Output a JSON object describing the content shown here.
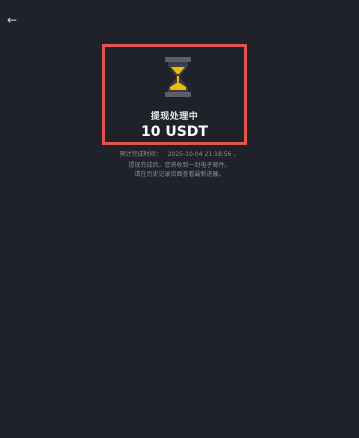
{
  "header": {
    "back_icon": "←"
  },
  "status": {
    "icon": "hourglass-icon",
    "title": "提现处理中",
    "amount": "10 USDT"
  },
  "eta": {
    "label": "预计完成时间：",
    "value": "2025-10-04 21:18:56 。"
  },
  "notice": {
    "line1": "提现完成后，您将收到一封电子邮件。",
    "line2": "请在历史记录页面查看最新进展。"
  },
  "colors": {
    "background": "#1f2228",
    "highlight_border": "#e2524f",
    "hourglass_sand": "#f0b90b",
    "hourglass_frame": "#5a5f69",
    "muted_text": "#8b909a"
  }
}
